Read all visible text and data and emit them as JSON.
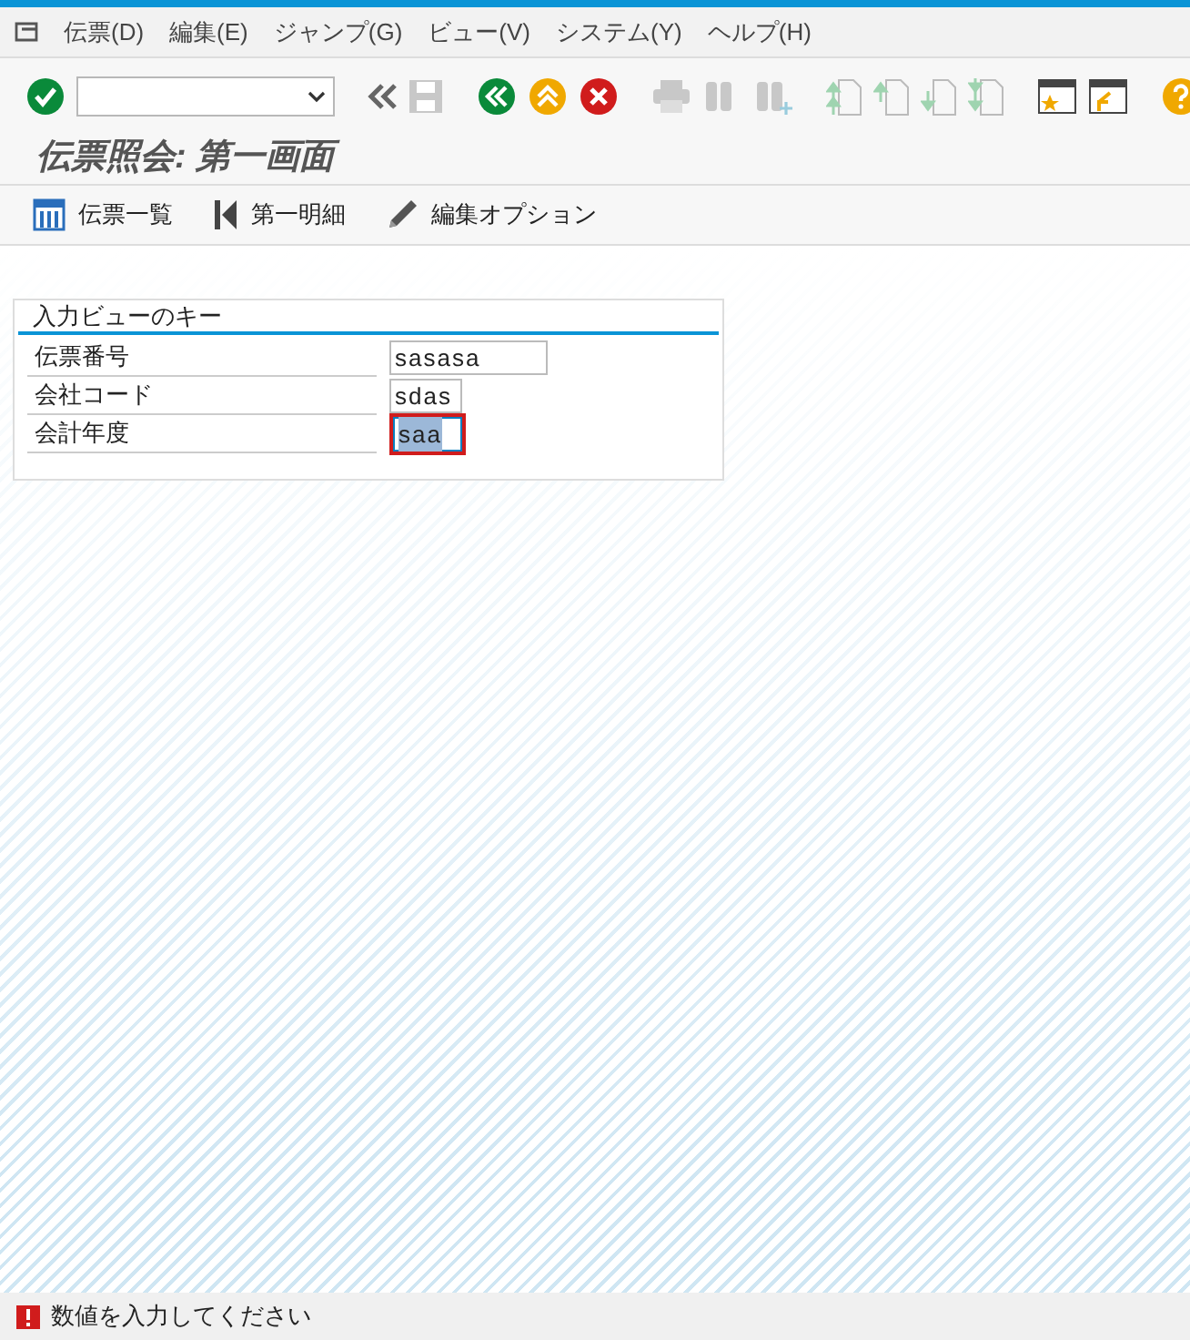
{
  "menu_bar": {
    "items": [
      {
        "label": "伝票(D)"
      },
      {
        "label": "編集(E)"
      },
      {
        "label": "ジャンプ(G)"
      },
      {
        "label": "ビュー(V)"
      },
      {
        "label": "システム(Y)"
      },
      {
        "label": "ヘルプ(H)"
      }
    ]
  },
  "toolbar": {
    "items": [
      {
        "kind": "enter",
        "disabled": false
      },
      {
        "kind": "command",
        "disabled": false
      },
      {
        "kind": "chevrons",
        "disabled": false
      },
      {
        "kind": "save",
        "disabled": true
      },
      {
        "kind": "back",
        "disabled": false
      },
      {
        "kind": "exit",
        "disabled": false
      },
      {
        "kind": "cancel",
        "disabled": false
      },
      {
        "kind": "print",
        "disabled": true
      },
      {
        "kind": "find",
        "disabled": true
      },
      {
        "kind": "find-next",
        "disabled": true
      },
      {
        "kind": "first",
        "disabled": true
      },
      {
        "kind": "prev",
        "disabled": true
      },
      {
        "kind": "next",
        "disabled": true
      },
      {
        "kind": "last",
        "disabled": true
      },
      {
        "kind": "new-window",
        "disabled": false
      },
      {
        "kind": "shortcut",
        "disabled": false
      },
      {
        "kind": "help",
        "disabled": false
      }
    ]
  },
  "title": "伝票照会: 第一画面",
  "app_toolbar": [
    {
      "kind": "list",
      "label": "伝票一覧"
    },
    {
      "kind": "first",
      "label": "第一明細"
    },
    {
      "kind": "edit",
      "label": "編集オプション"
    }
  ],
  "group": {
    "title": "入力ビューのキー",
    "fields": [
      {
        "label": "伝票番号",
        "value": "sasasa",
        "error": false
      },
      {
        "label": "会社コード",
        "value": "sdas",
        "error": false
      },
      {
        "label": "会計年度",
        "value": "saa",
        "error": true
      }
    ]
  },
  "status_bar": {
    "kind": "error",
    "message": "数値を入力してください"
  }
}
